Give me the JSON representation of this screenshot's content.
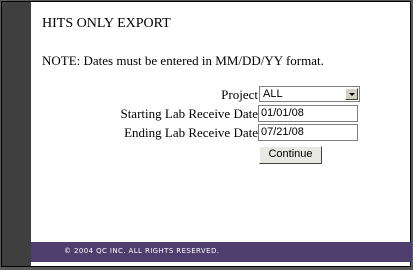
{
  "page": {
    "title": "HITS ONLY EXPORT",
    "note": "NOTE: Dates must be entered in MM/DD/YY format."
  },
  "form": {
    "project_label": "Project",
    "project_value": "ALL",
    "start_label": "Starting Lab Receive Date",
    "start_value": "01/01/08",
    "end_label": "Ending Lab Receive Date",
    "end_value": "07/21/08",
    "continue_label": "Continue"
  },
  "footer": {
    "copyright": "© 2004 QC INC.  ALL RIGHTS RESERVED."
  }
}
